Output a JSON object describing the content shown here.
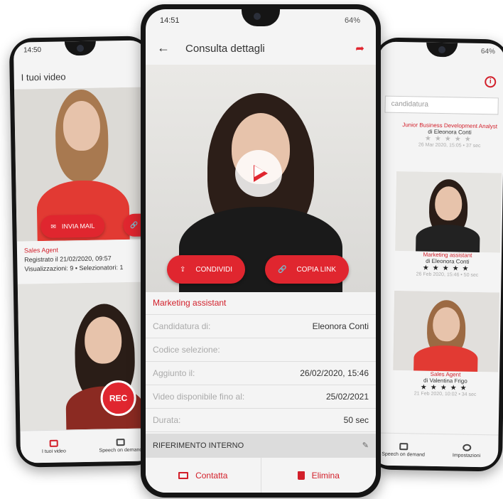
{
  "left_phone": {
    "status_time": "14:50",
    "title": "I tuoi video",
    "send_mail_label": "INVIA MAIL",
    "role": "Sales Agent",
    "registered": "Registrato il 21/02/2020, 09:57",
    "stats": "Visualizzazioni: 9 • Selezionatori: 1",
    "rec_label": "REC",
    "nav": [
      "I tuoi video",
      "Speech on demand"
    ]
  },
  "center_phone": {
    "status_time": "14:51",
    "status_battery": "64%",
    "title": "Consulta dettagli",
    "share_label": "CONDIVIDI",
    "copy_link_label": "COPIA LINK",
    "job_title": "Marketing assistant",
    "details": [
      {
        "key": "Candidatura di:",
        "value": "Eleonora Conti"
      },
      {
        "key": "Codice selezione:",
        "value": ""
      },
      {
        "key": "Aggiunto il:",
        "value": "26/02/2020, 15:46"
      },
      {
        "key": "Video disponibile fino al:",
        "value": "25/02/2021"
      },
      {
        "key": "Durata:",
        "value": "50 sec"
      }
    ],
    "section_label": "RIFERIMENTO INTERNO",
    "contact_label": "Contatta",
    "delete_label": "Elimina"
  },
  "right_phone": {
    "status_battery": "64%",
    "search_placeholder": "candidatura",
    "cards": [
      {
        "title": "Junior Business Development Analyst",
        "by": "di Eleonora Conti",
        "meta": "26 Mar 2020, 15:05 • 37 sec"
      },
      {
        "title": "Marketing assistant",
        "by": "di Eleonora Conti",
        "meta": "26 Feb 2020, 15:46 • 50 sec"
      },
      {
        "title": "Sales Agent",
        "by": "di Valentina Frigo",
        "meta": "21 Feb 2020, 10:02 • 34 sec"
      }
    ],
    "nav": [
      "Speech on demand",
      "Impostazioni"
    ]
  }
}
